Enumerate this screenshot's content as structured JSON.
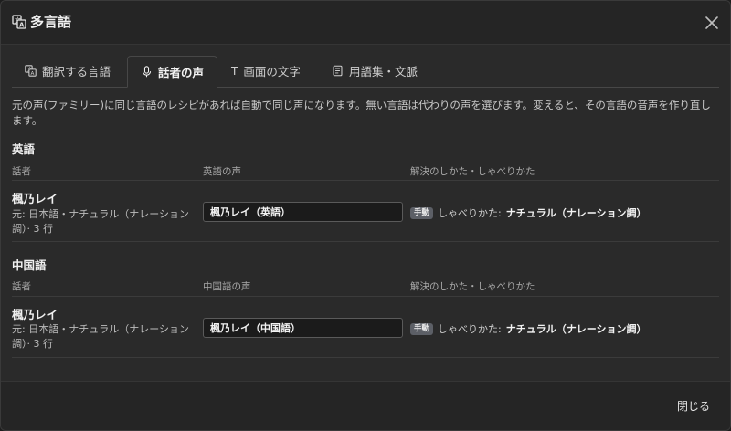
{
  "dialog": {
    "title": "多言語",
    "title_icon": "translate-icon",
    "close_icon": "close-icon",
    "close_label": "閉じる"
  },
  "tabs": [
    {
      "label": "翻訳する言語",
      "icon": "translate-icon",
      "active": false
    },
    {
      "label": "話者の声",
      "icon": "microphone-icon",
      "active": true
    },
    {
      "label": "画面の文字",
      "icon": "text-icon",
      "active": false
    },
    {
      "label": "用語集・文脈",
      "icon": "document-icon",
      "active": false
    }
  ],
  "description": "元の声(ファミリー)に同じ言語のレシピがあれば自動で同じ声になります。無い言語は代わりの声を選びます。変えると、その言語の音声を作り直します。",
  "sections": [
    {
      "title": "英語",
      "columns": [
        "話者",
        "英語の声",
        "解決のしかた・しゃべりかた"
      ],
      "speaker": {
        "name": "楓乃レイ",
        "meta": "元: 日本語・ナチュラル（ナレーション調）· 3 行",
        "voice_value": "楓乃レイ（英語）",
        "badge": "手動",
        "resolve_label": "しゃべりかた:",
        "resolve_value": "ナチュラル（ナレーション調）"
      }
    },
    {
      "title": "中国語",
      "columns": [
        "話者",
        "中国語の声",
        "解決のしかた・しゃべりかた"
      ],
      "speaker": {
        "name": "楓乃レイ",
        "meta": "元: 日本語・ナチュラル（ナレーション調）· 3 行",
        "voice_value": "楓乃レイ（中国語）",
        "badge": "手動",
        "resolve_label": "しゃべりかた:",
        "resolve_value": "ナチュラル（ナレーション調）"
      }
    }
  ]
}
